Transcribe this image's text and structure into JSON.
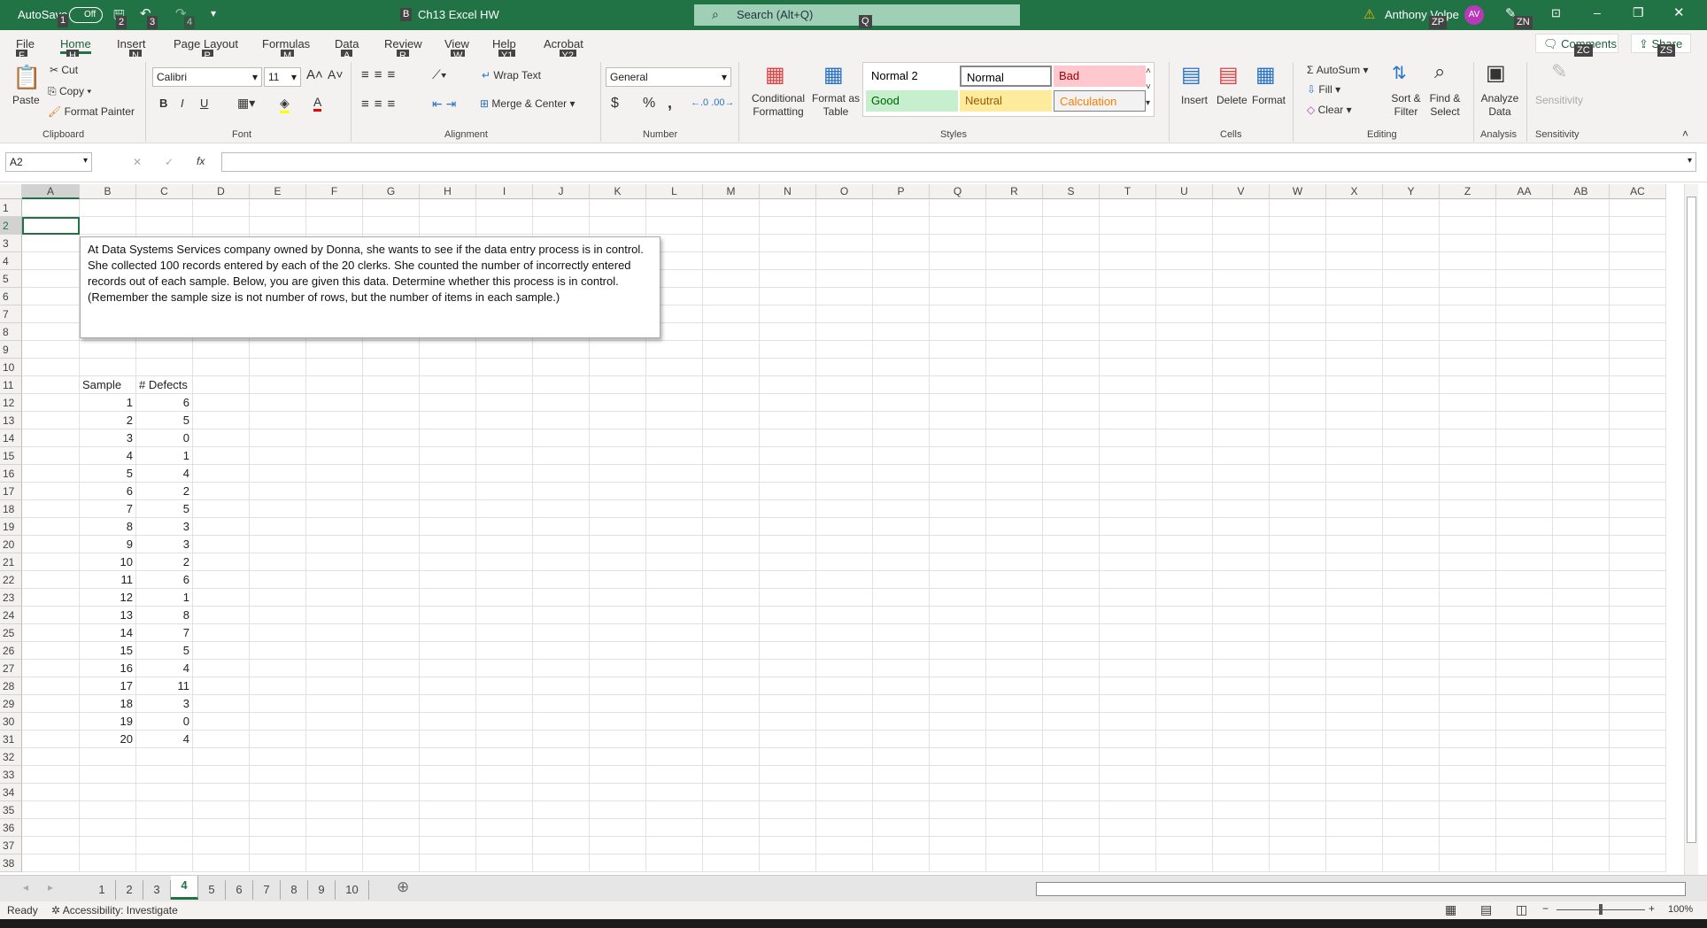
{
  "titlebar": {
    "autosave": "AutoSave",
    "autosave_state": "Off",
    "file_prefix": "B",
    "title": "Ch13 Excel HW",
    "search_placeholder": "Search (Alt+Q)",
    "user": "Anthony Volpe",
    "avatar": "AV",
    "keytips": [
      "1",
      "2",
      "3",
      "4",
      "Q",
      "ZP",
      "ZN"
    ]
  },
  "tabs": [
    {
      "label": "File",
      "key": "F"
    },
    {
      "label": "Home",
      "key": "H"
    },
    {
      "label": "Insert",
      "key": "N"
    },
    {
      "label": "Page Layout",
      "key": "P"
    },
    {
      "label": "Formulas",
      "key": "M"
    },
    {
      "label": "Data",
      "key": "A"
    },
    {
      "label": "Review",
      "key": "R"
    },
    {
      "label": "View",
      "key": "W"
    },
    {
      "label": "Help",
      "key": "Y1"
    },
    {
      "label": "Acrobat",
      "key": "Y2"
    }
  ],
  "active_tab": "Home",
  "comments": {
    "label": "Comments",
    "key": "ZC"
  },
  "share": {
    "label": "Share",
    "key": "ZS"
  },
  "ribbon": {
    "clipboard": {
      "paste": "Paste",
      "cut": "Cut",
      "copy": "Copy",
      "format_painter": "Format Painter",
      "group": "Clipboard"
    },
    "font": {
      "name": "Calibri",
      "size": "11",
      "bold": "B",
      "italic": "I",
      "underline": "U",
      "group": "Font"
    },
    "alignment": {
      "wrap": "Wrap Text",
      "merge": "Merge & Center",
      "group": "Alignment"
    },
    "number": {
      "format": "General",
      "currency": "$",
      "percent": "%",
      "comma": ",",
      "group": "Number"
    },
    "styles": {
      "conditional": "Conditional Formatting",
      "format_table": "Format as Table",
      "cells": [
        {
          "label": "Normal 2",
          "bg": "#ffffff",
          "fg": "#000000"
        },
        {
          "label": "Normal",
          "bg": "#ffffff",
          "fg": "#000000"
        },
        {
          "label": "Bad",
          "bg": "#ffc7ce",
          "fg": "#9c0006"
        },
        {
          "label": "Good",
          "bg": "#c6efce",
          "fg": "#006100"
        },
        {
          "label": "Neutral",
          "bg": "#ffeb9c",
          "fg": "#9c5700"
        },
        {
          "label": "Calculation",
          "bg": "#f2f2f2",
          "fg": "#fa7d00"
        }
      ],
      "group": "Styles"
    },
    "cells": {
      "insert": "Insert",
      "delete": "Delete",
      "format": "Format",
      "group": "Cells"
    },
    "editing": {
      "autosum": "AutoSum",
      "fill": "Fill",
      "clear": "Clear",
      "sort": "Sort & Filter",
      "find": "Find & Select",
      "group": "Editing"
    },
    "analysis": {
      "analyze": "Analyze Data",
      "group": "Analysis"
    },
    "sensitivity": {
      "label": "Sensitivity",
      "group": "Sensitivity"
    }
  },
  "formula_bar": {
    "name_box": "A2",
    "fx": "fx",
    "value": ""
  },
  "columns": [
    "A",
    "B",
    "C",
    "D",
    "E",
    "F",
    "G",
    "H",
    "I",
    "J",
    "K",
    "L",
    "M",
    "N",
    "O",
    "P",
    "Q",
    "R",
    "S",
    "T",
    "U",
    "V",
    "W",
    "X",
    "Y",
    "Z",
    "AA",
    "AB",
    "AC"
  ],
  "row_count": 38,
  "selected_cell": "A2",
  "textbox": "At Data Systems Services company owned by Donna, she wants to see if the data entry process is in control. She collected 100 records entered by each of the 20 clerks. She counted the number of incorrectly entered records out of each sample. Below, you are given this data.  Determine whether this process is in control. (Remember the sample size is not number of rows, but the number of items in each sample.)",
  "table": {
    "header_row": 11,
    "headers": [
      "Sample",
      "# Defects"
    ],
    "rows": [
      [
        1,
        6
      ],
      [
        2,
        5
      ],
      [
        3,
        0
      ],
      [
        4,
        1
      ],
      [
        5,
        4
      ],
      [
        6,
        2
      ],
      [
        7,
        5
      ],
      [
        8,
        3
      ],
      [
        9,
        3
      ],
      [
        10,
        2
      ],
      [
        11,
        6
      ],
      [
        12,
        1
      ],
      [
        13,
        8
      ],
      [
        14,
        7
      ],
      [
        15,
        5
      ],
      [
        16,
        4
      ],
      [
        17,
        11
      ],
      [
        18,
        3
      ],
      [
        19,
        0
      ],
      [
        20,
        4
      ]
    ]
  },
  "sheets": [
    "1",
    "2",
    "3",
    "4",
    "5",
    "6",
    "7",
    "8",
    "9",
    "10"
  ],
  "active_sheet": "4",
  "status": {
    "ready": "Ready",
    "accessibility": "Accessibility: Investigate",
    "zoom": "100%"
  },
  "colors": {
    "accent": "#217346"
  }
}
